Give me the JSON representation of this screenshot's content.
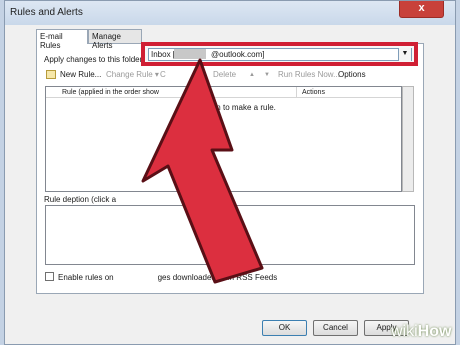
{
  "window": {
    "title": "Rules and Alerts",
    "close_glyph": "x"
  },
  "tabs": [
    {
      "label": "E-mail Rules"
    },
    {
      "label": "Manage Alerts"
    }
  ],
  "apply": {
    "label": "Apply changes to this folder:",
    "folder_prefix": "Inbox [",
    "folder_suffix": "@outlook.com]",
    "dropdown_glyph": "▼"
  },
  "toolbar": {
    "new_rule": "New Rule...",
    "change_rule": "Change Rule ▾",
    "copy": "C",
    "delete": "Delete",
    "up": "▲",
    "down": "▼",
    "run_rules": "Run Rules Now...",
    "options": "Options"
  },
  "rules_list": {
    "col_rule": "Rule (applied in the order show",
    "col_actions": "Actions",
    "empty_message": "Rule\" button to make a rule."
  },
  "description": {
    "label_start": "Rule de",
    "label_mid": "ption (click a",
    "label_end": "e):"
  },
  "rss": {
    "label_start": "Enable rules on",
    "label_end": "ges downloaded from RSS Feeds"
  },
  "buttons": {
    "ok": "OK",
    "cancel": "Cancel",
    "apply": "Apply"
  },
  "watermark": {
    "wiki": "wiki",
    "how": "How"
  },
  "colors": {
    "highlight_red": "#d01f34",
    "arrow_red": "#dc2f3f"
  }
}
